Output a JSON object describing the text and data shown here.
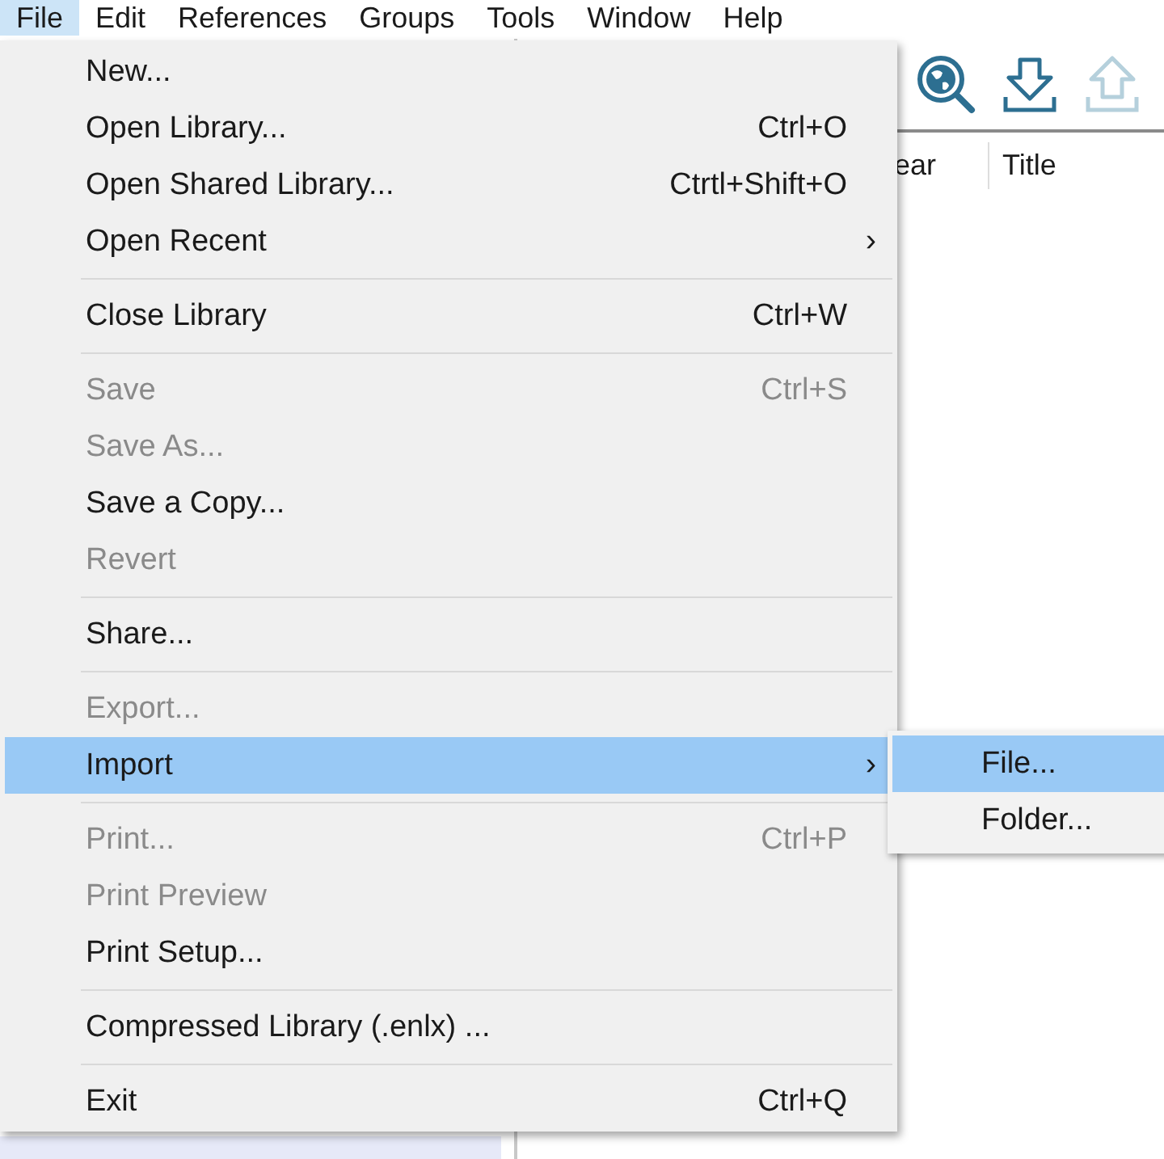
{
  "menubar": [
    {
      "label": "File",
      "selected": true
    },
    {
      "label": "Edit",
      "selected": false
    },
    {
      "label": "References",
      "selected": false
    },
    {
      "label": "Groups",
      "selected": false
    },
    {
      "label": "Tools",
      "selected": false
    },
    {
      "label": "Window",
      "selected": false
    },
    {
      "label": "Help",
      "selected": false
    }
  ],
  "toolbar": [
    {
      "kind": "globe-search",
      "disabled": false
    },
    {
      "kind": "download",
      "disabled": false
    },
    {
      "kind": "upload",
      "disabled": true
    }
  ],
  "reference_list": {
    "columns": [
      "ear",
      "Title"
    ]
  },
  "file_menu": [
    {
      "kind": "item",
      "label": "New...",
      "disabled": false,
      "selected": false
    },
    {
      "kind": "item",
      "label": "Open Library...",
      "shortcut": "Ctrl+O",
      "disabled": false,
      "selected": false
    },
    {
      "kind": "item",
      "label": "Open Shared Library...",
      "shortcut": "Ctrtl+Shift+O",
      "disabled": false,
      "selected": false
    },
    {
      "kind": "submenu",
      "label": "Open Recent",
      "arrow": "›",
      "disabled": false,
      "selected": false
    },
    {
      "kind": "separator"
    },
    {
      "kind": "item",
      "label": "Close Library",
      "shortcut": "Ctrl+W",
      "disabled": false,
      "selected": false
    },
    {
      "kind": "separator"
    },
    {
      "kind": "item",
      "label": "Save",
      "shortcut": "Ctrl+S",
      "disabled": true,
      "selected": false
    },
    {
      "kind": "item",
      "label": "Save As...",
      "disabled": true,
      "selected": false
    },
    {
      "kind": "item",
      "label": "Save a Copy...",
      "disabled": false,
      "selected": false
    },
    {
      "kind": "item",
      "label": "Revert",
      "disabled": true,
      "selected": false
    },
    {
      "kind": "separator"
    },
    {
      "kind": "item",
      "label": "Share...",
      "disabled": false,
      "selected": false
    },
    {
      "kind": "separator"
    },
    {
      "kind": "item",
      "label": "Export...",
      "disabled": true,
      "selected": false
    },
    {
      "kind": "submenu",
      "label": "Import",
      "arrow": "›",
      "disabled": false,
      "selected": true
    },
    {
      "kind": "separator"
    },
    {
      "kind": "item",
      "label": "Print...",
      "shortcut": "Ctrl+P",
      "disabled": true,
      "selected": false
    },
    {
      "kind": "item",
      "label": "Print Preview",
      "disabled": true,
      "selected": false
    },
    {
      "kind": "item",
      "label": "Print Setup...",
      "disabled": false,
      "selected": false
    },
    {
      "kind": "separator"
    },
    {
      "kind": "item",
      "label": "Compressed Library (.enlx) ...",
      "disabled": false,
      "selected": false
    },
    {
      "kind": "separator"
    },
    {
      "kind": "item",
      "label": "Exit",
      "shortcut": "Ctrl+Q",
      "disabled": false,
      "selected": false
    }
  ],
  "import_submenu": [
    {
      "label": "File...",
      "selected": true
    },
    {
      "label": "Folder...",
      "selected": false
    }
  ]
}
